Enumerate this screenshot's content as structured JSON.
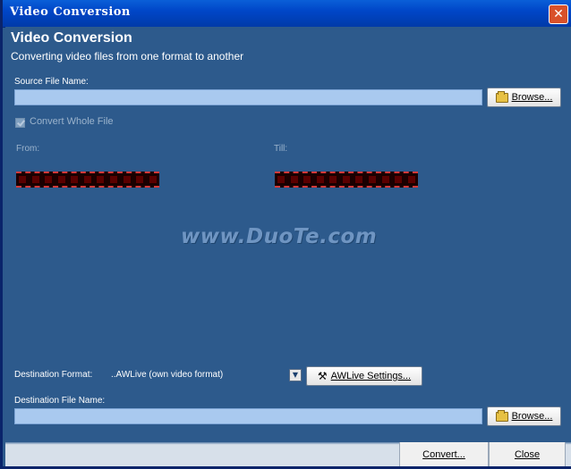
{
  "window": {
    "title": "Video Conversion",
    "close_glyph": "✕"
  },
  "header": {
    "title": "Video Conversion",
    "subtitle": "Converting video files from one format to another"
  },
  "source": {
    "label": "Source File Name:",
    "value": "",
    "browse_label": "Browse..."
  },
  "convert_whole": {
    "label": "Convert Whole File",
    "checked": true
  },
  "range": {
    "from_label": "From:",
    "till_label": "Till:"
  },
  "destination": {
    "format_label": "Destination Format:",
    "format_value": "..AWLive (own video format)",
    "settings_label": "AWLive Settings...",
    "file_label": "Destination File Name:",
    "file_value": "",
    "browse_label": "Browse..."
  },
  "footer": {
    "convert_label": "Convert...",
    "close_label": "Close"
  },
  "watermark": {
    "text": "www.DuoTe.com"
  },
  "icons": {
    "folder": "folder-icon",
    "tools": "tools-icon",
    "dropdown": "chevron-down-icon"
  },
  "colors": {
    "title_bar": "#0046c8",
    "background": "#2d5a8c",
    "field": "#a9c9ef",
    "close_button": "#d9512a"
  }
}
